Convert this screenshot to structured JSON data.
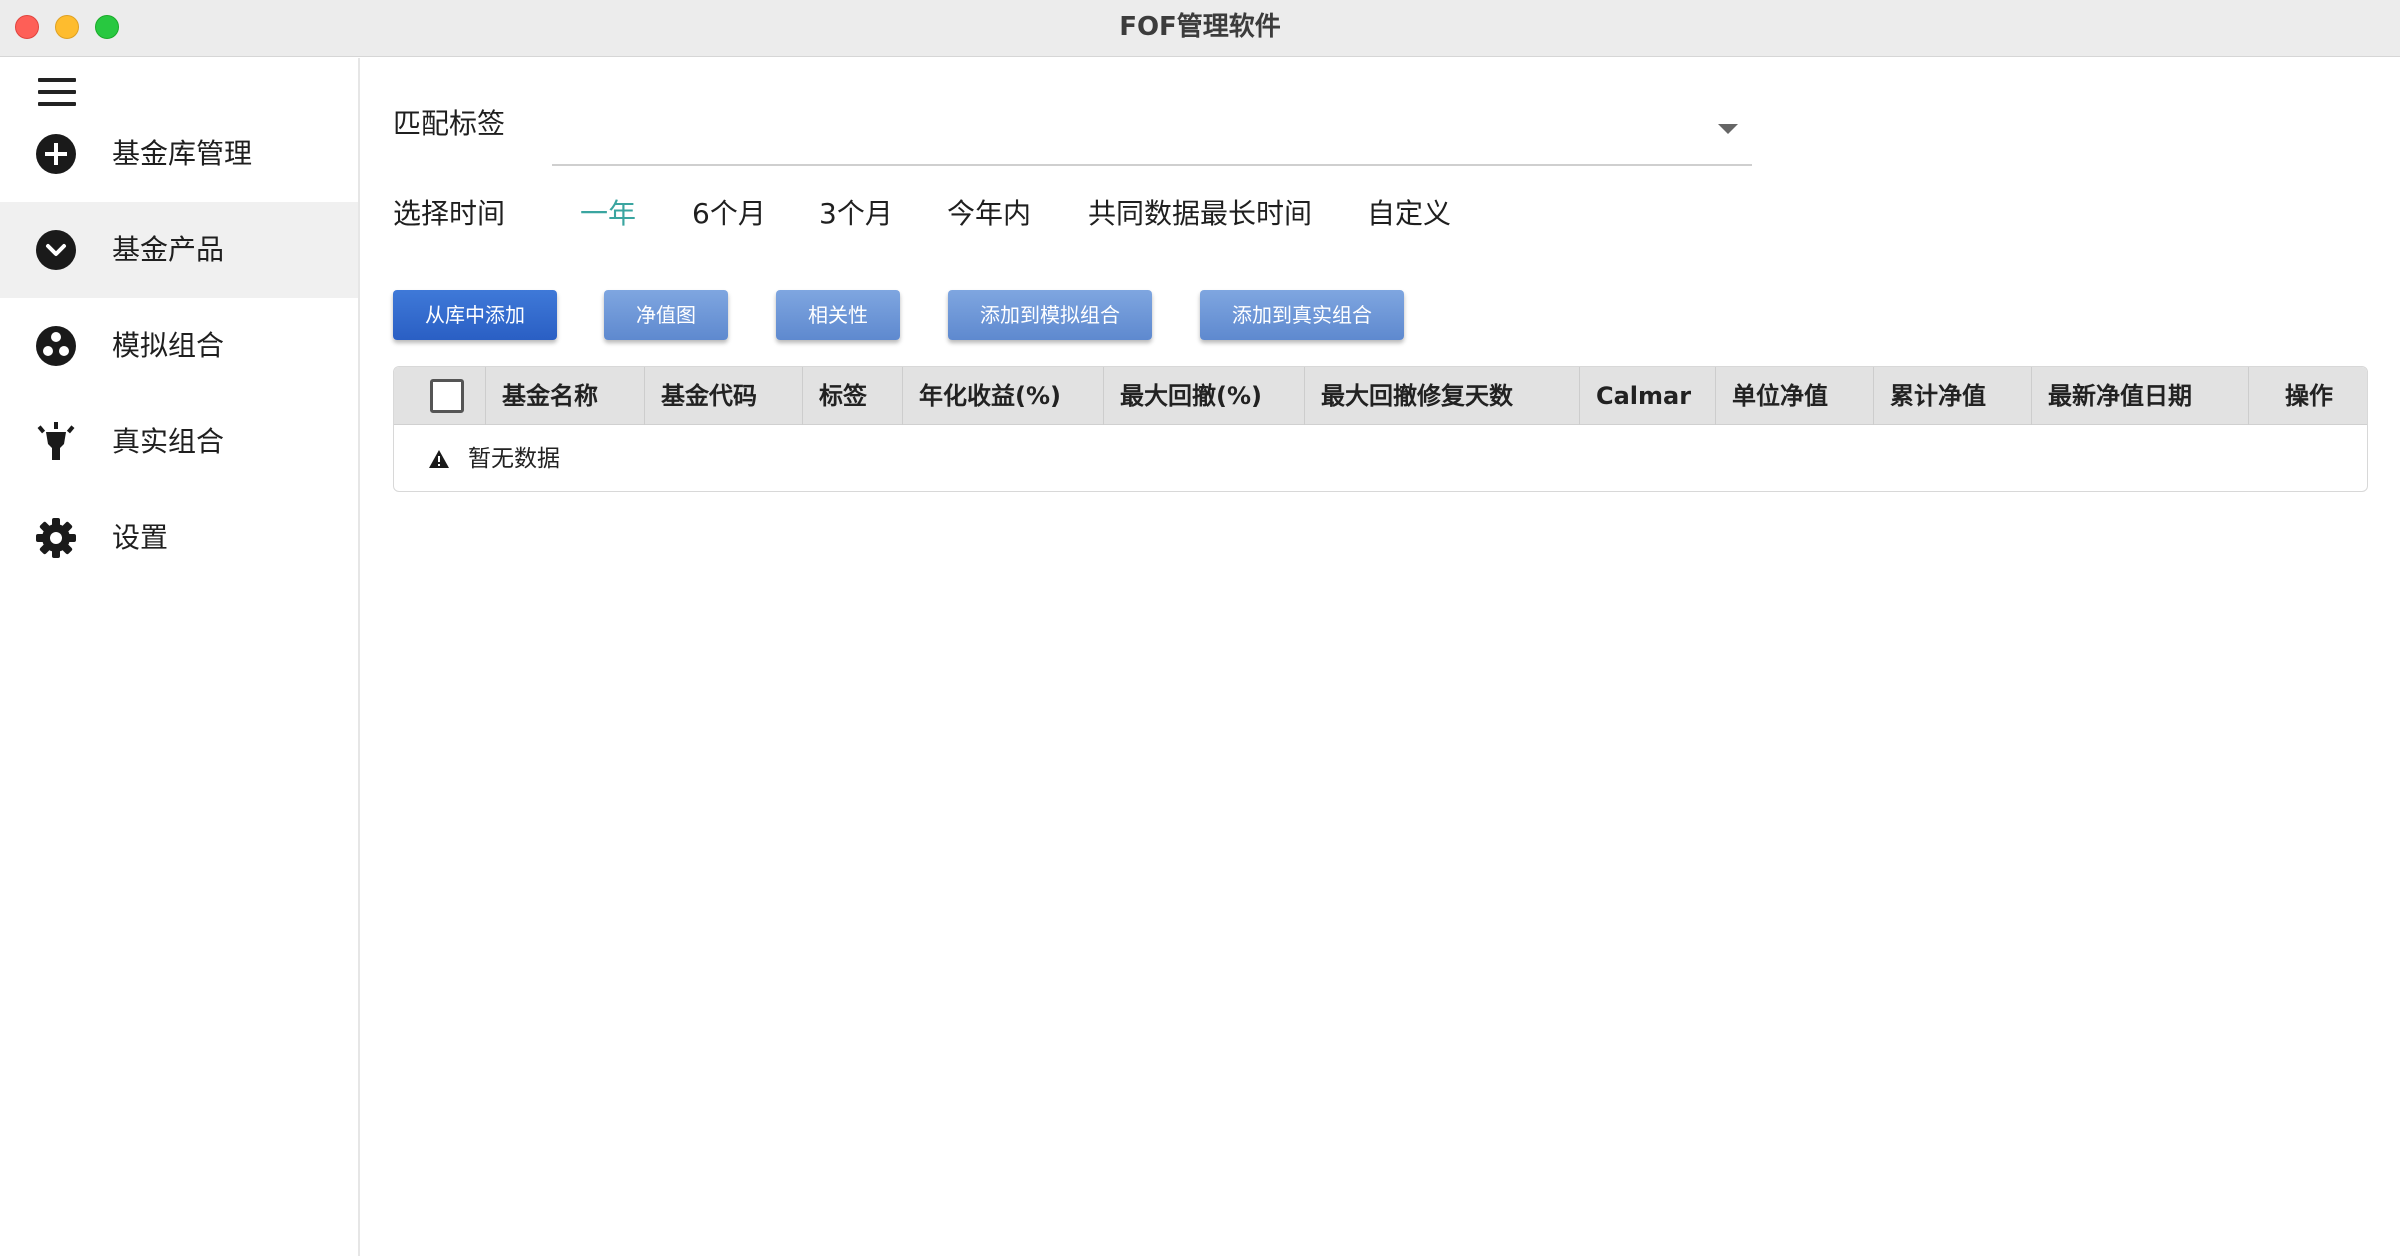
{
  "window": {
    "title": "FOF管理软件"
  },
  "sidebar": {
    "items": [
      {
        "label": "基金库管理",
        "icon": "add-circle-icon"
      },
      {
        "label": "基金产品",
        "icon": "chevron-down-circle-icon",
        "active": true
      },
      {
        "label": "模拟组合",
        "icon": "bubble-chart-icon"
      },
      {
        "label": "真实组合",
        "icon": "lightbulb-icon"
      },
      {
        "label": "设置",
        "icon": "gear-icon"
      }
    ]
  },
  "filters": {
    "tag_label": "匹配标签",
    "time_label": "选择时间",
    "time_options": [
      "一年",
      "6个月",
      "3个月",
      "今年内",
      "共同数据最长时间",
      "自定义"
    ],
    "active_time_option": "一年"
  },
  "toolbar": {
    "add_from_library": "从库中添加",
    "nav_chart": "净值图",
    "correlation": "相关性",
    "add_to_simulated": "添加到模拟组合",
    "add_to_real": "添加到真实组合"
  },
  "table": {
    "columns": [
      "基金名称",
      "基金代码",
      "标签",
      "年化收益(%)",
      "最大回撤(%)",
      "最大回撤修复天数",
      "Calmar",
      "单位净值",
      "累计净值",
      "最新净值日期",
      "操作"
    ],
    "empty_text": "暂无数据"
  },
  "colors": {
    "accent_active": "#3aa5a0",
    "primary_button": "#2f68cc",
    "secondary_button": "#6f97d8"
  }
}
